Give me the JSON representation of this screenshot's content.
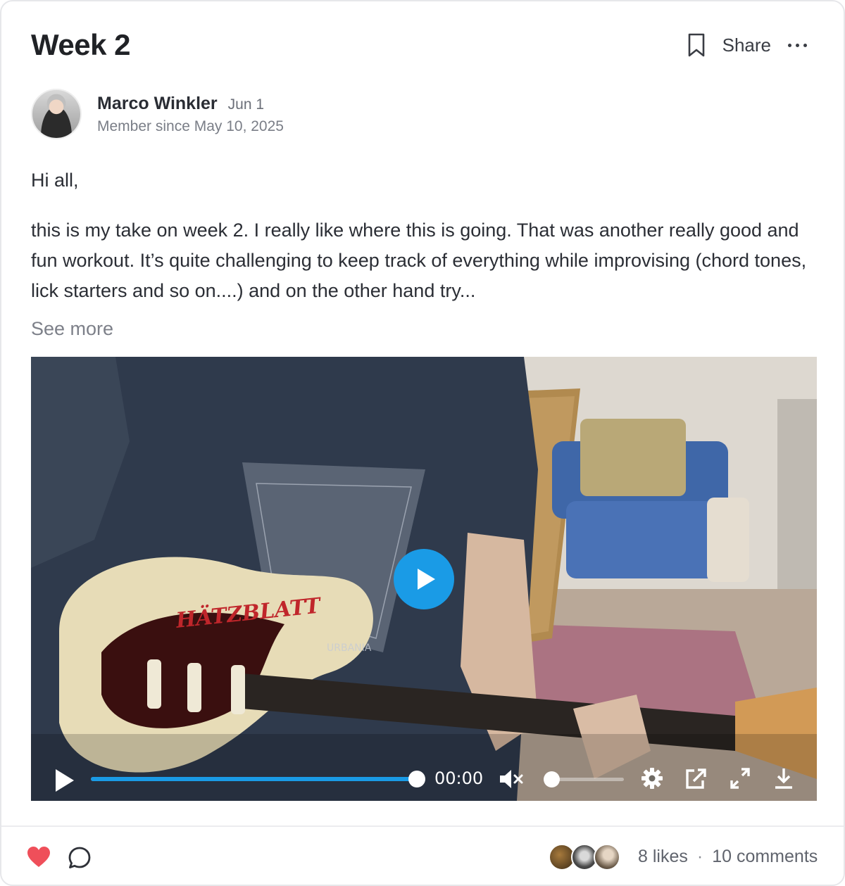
{
  "post": {
    "title": "Week 2",
    "actions": {
      "share_label": "Share",
      "bookmark_icon": "bookmark-icon",
      "more_icon": "more-dots-icon"
    },
    "author": {
      "name": "Marco Winkler",
      "date": "Jun 1",
      "member_since": "Member since May 10, 2025"
    },
    "greeting": "Hi all,",
    "paragraph": "this is my take on week 2. I really like where this is going. That was another really good and fun workout. It’s quite challenging to keep track of everything while improvising (chord tones, lick starters and so on....) and on the other hand try...",
    "see_more": "See more"
  },
  "video": {
    "time": "00:00",
    "progress": 1.0,
    "volume": 0.0,
    "muted": true,
    "accent_color": "#1a9be6",
    "guitar_label": "HÄTZBLATT",
    "shirt_text": "URBANIA"
  },
  "footer": {
    "likes": "8 likes",
    "separator": "·",
    "comments": "10 comments",
    "heart_color": "#ef4f5a"
  }
}
